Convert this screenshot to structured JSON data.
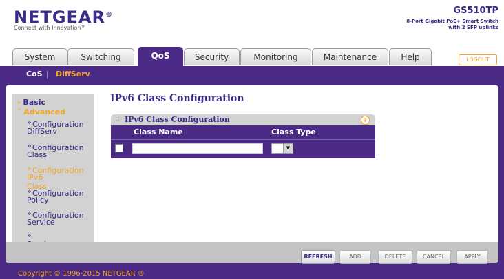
{
  "header": {
    "brand": "NETGEAR",
    "brand_mark": "®",
    "tagline": "Connect with Innovation™",
    "model": "GS510TP",
    "model_desc_line1": "8-Port Gigabit PoE+ Smart Switch",
    "model_desc_line2": "with 2 SFP uplinks"
  },
  "tabs": [
    {
      "label": "System",
      "active": false
    },
    {
      "label": "Switching",
      "active": false
    },
    {
      "label": "QoS",
      "active": true
    },
    {
      "label": "Security",
      "active": false
    },
    {
      "label": "Monitoring",
      "active": false
    },
    {
      "label": "Maintenance",
      "active": false
    },
    {
      "label": "Help",
      "active": false
    }
  ],
  "logout_label": "LOGOUT",
  "subnav": {
    "cos": "CoS",
    "separator": "|",
    "diffserv": "DiffServ"
  },
  "sidebar": {
    "basic": "Basic",
    "advanced": "Advanced",
    "items": [
      {
        "line1": "» DiffServ",
        "line2": "Configuration",
        "active": false
      },
      {
        "line1": "» Class",
        "line2": "Configuration",
        "active": false
      },
      {
        "line1": "» IPv6 Class",
        "line2": "Configuration",
        "active": true
      },
      {
        "line1": "» Policy",
        "line2": "Configuration",
        "active": false
      },
      {
        "line1": "» Service",
        "line2": "Configuration",
        "active": false
      },
      {
        "line1": "» Service Statistics",
        "line2": "",
        "active": false
      }
    ]
  },
  "page": {
    "title": "IPv6 Class Configuration",
    "panel_title": "IPv6 Class Configuration",
    "help": "?",
    "table": {
      "headers": [
        "Class Name",
        "Class Type"
      ],
      "row": {
        "class_name": "",
        "class_type": ""
      }
    }
  },
  "buttons": {
    "refresh": "REFRESH",
    "add": "ADD",
    "delete": "DELETE",
    "cancel": "CANCEL",
    "apply": "APPLY"
  },
  "copyright": "Copyright © 1996-2015 NETGEAR ®",
  "colors": {
    "brand_purple": "#4b2a85",
    "accent_orange": "#f3a523",
    "sidebar_gray": "#d2d2d2"
  }
}
